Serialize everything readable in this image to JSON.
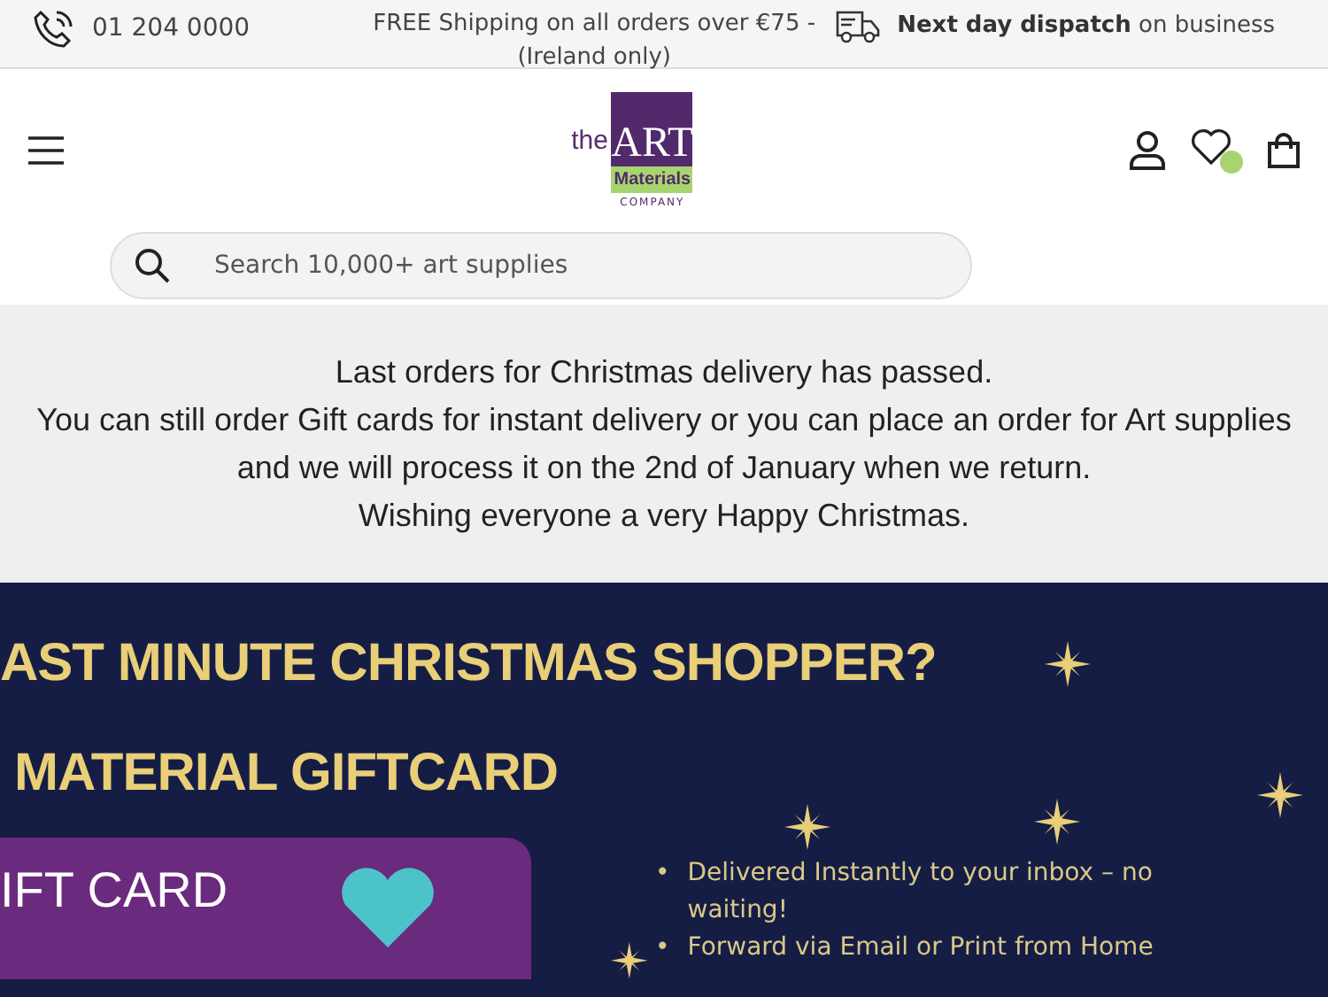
{
  "top_bar": {
    "phone": "01 204 0000",
    "shipping": "FREE Shipping on all orders over €75 - (Ireland only)",
    "dispatch": "**Next day dispatch** on business"
  },
  "header": {
    "logo": {
      "the": "the",
      "art": "ART",
      "materials": "Materials",
      "company": "COMPANY"
    }
  },
  "search": {
    "placeholder": "Search 10,000+ art supplies"
  },
  "notice": [
    "Last orders for Christmas delivery has passed.",
    "You can still order Gift cards for instant delivery or you can place an order for Art supplies and we will process it on the 2nd of January when we return.",
    "Wishing everyone a very Happy Christmas."
  ],
  "banner": {
    "headline": "AST MINUTE CHRISTMAS SHOPPER?",
    "subheadline": "MATERIAL GIFTCARD",
    "card_label": "IFT CARD",
    "bullet": "•",
    "bullets": [
      "Delivered Instantly to your inbox – no waiting!",
      "Forward via Email or Print from Home"
    ]
  }
}
